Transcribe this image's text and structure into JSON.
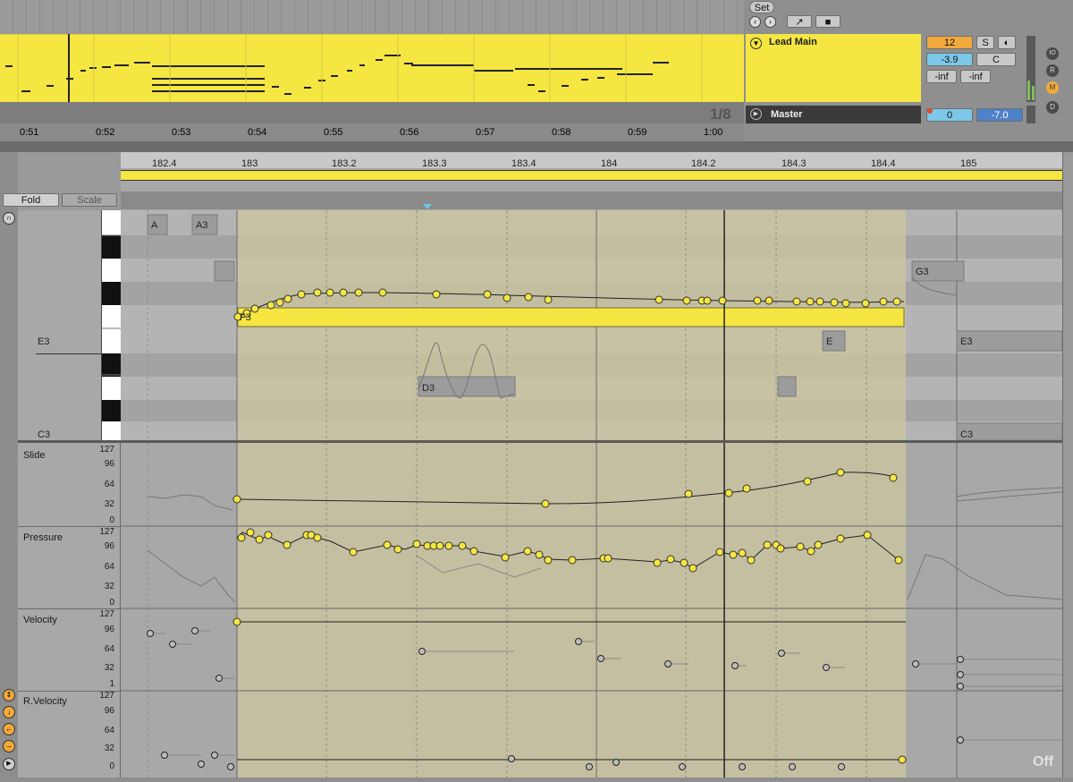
{
  "arrangement": {
    "time_labels": [
      "0:51",
      "0:52",
      "0:53",
      "0:54",
      "0:55",
      "0:56",
      "0:57",
      "0:58",
      "0:59",
      "1:00"
    ],
    "grid_label": "1/8"
  },
  "track": {
    "set_label": "Set",
    "name": "Lead Main",
    "volume": "12",
    "solo": "S",
    "pan_value": "-3.9",
    "pan_label": "C",
    "meter_left": "-inf",
    "meter_right": "-inf",
    "master_name": "Master",
    "master_value_a": "0",
    "master_value_b": "-7.0",
    "side_buttons": [
      "IO",
      "R",
      "M",
      "D"
    ]
  },
  "editor": {
    "fold_label": "Fold",
    "scale_label": "Scale",
    "ruler": [
      "182.4",
      "183",
      "183.2",
      "183.3",
      "183.4",
      "184",
      "184.2",
      "184.3",
      "184.4",
      "185"
    ],
    "piano_labels": [
      "E3",
      "C3"
    ],
    "notes": [
      "A",
      "A3",
      "F3",
      "G3",
      "E",
      "E3",
      "D3",
      "C3"
    ],
    "lanes": [
      {
        "name": "Slide",
        "ticks": [
          "127",
          "96",
          "64",
          "32",
          "0"
        ]
      },
      {
        "name": "Pressure",
        "ticks": [
          "127",
          "96",
          "64",
          "32",
          "0"
        ]
      },
      {
        "name": "Velocity",
        "ticks": [
          "127",
          "96",
          "64",
          "32",
          "1"
        ]
      },
      {
        "name": "R.Velocity",
        "ticks": [
          "127",
          "96",
          "64",
          "32",
          "0"
        ]
      }
    ],
    "status": "Off"
  },
  "colors": {
    "clip_yellow": "#f5e642",
    "selection_tan": "#c2bd96",
    "panel_gray": "#8e8e8e",
    "accent_orange": "#f2a93b",
    "accent_blue": "#7cc8e8"
  }
}
